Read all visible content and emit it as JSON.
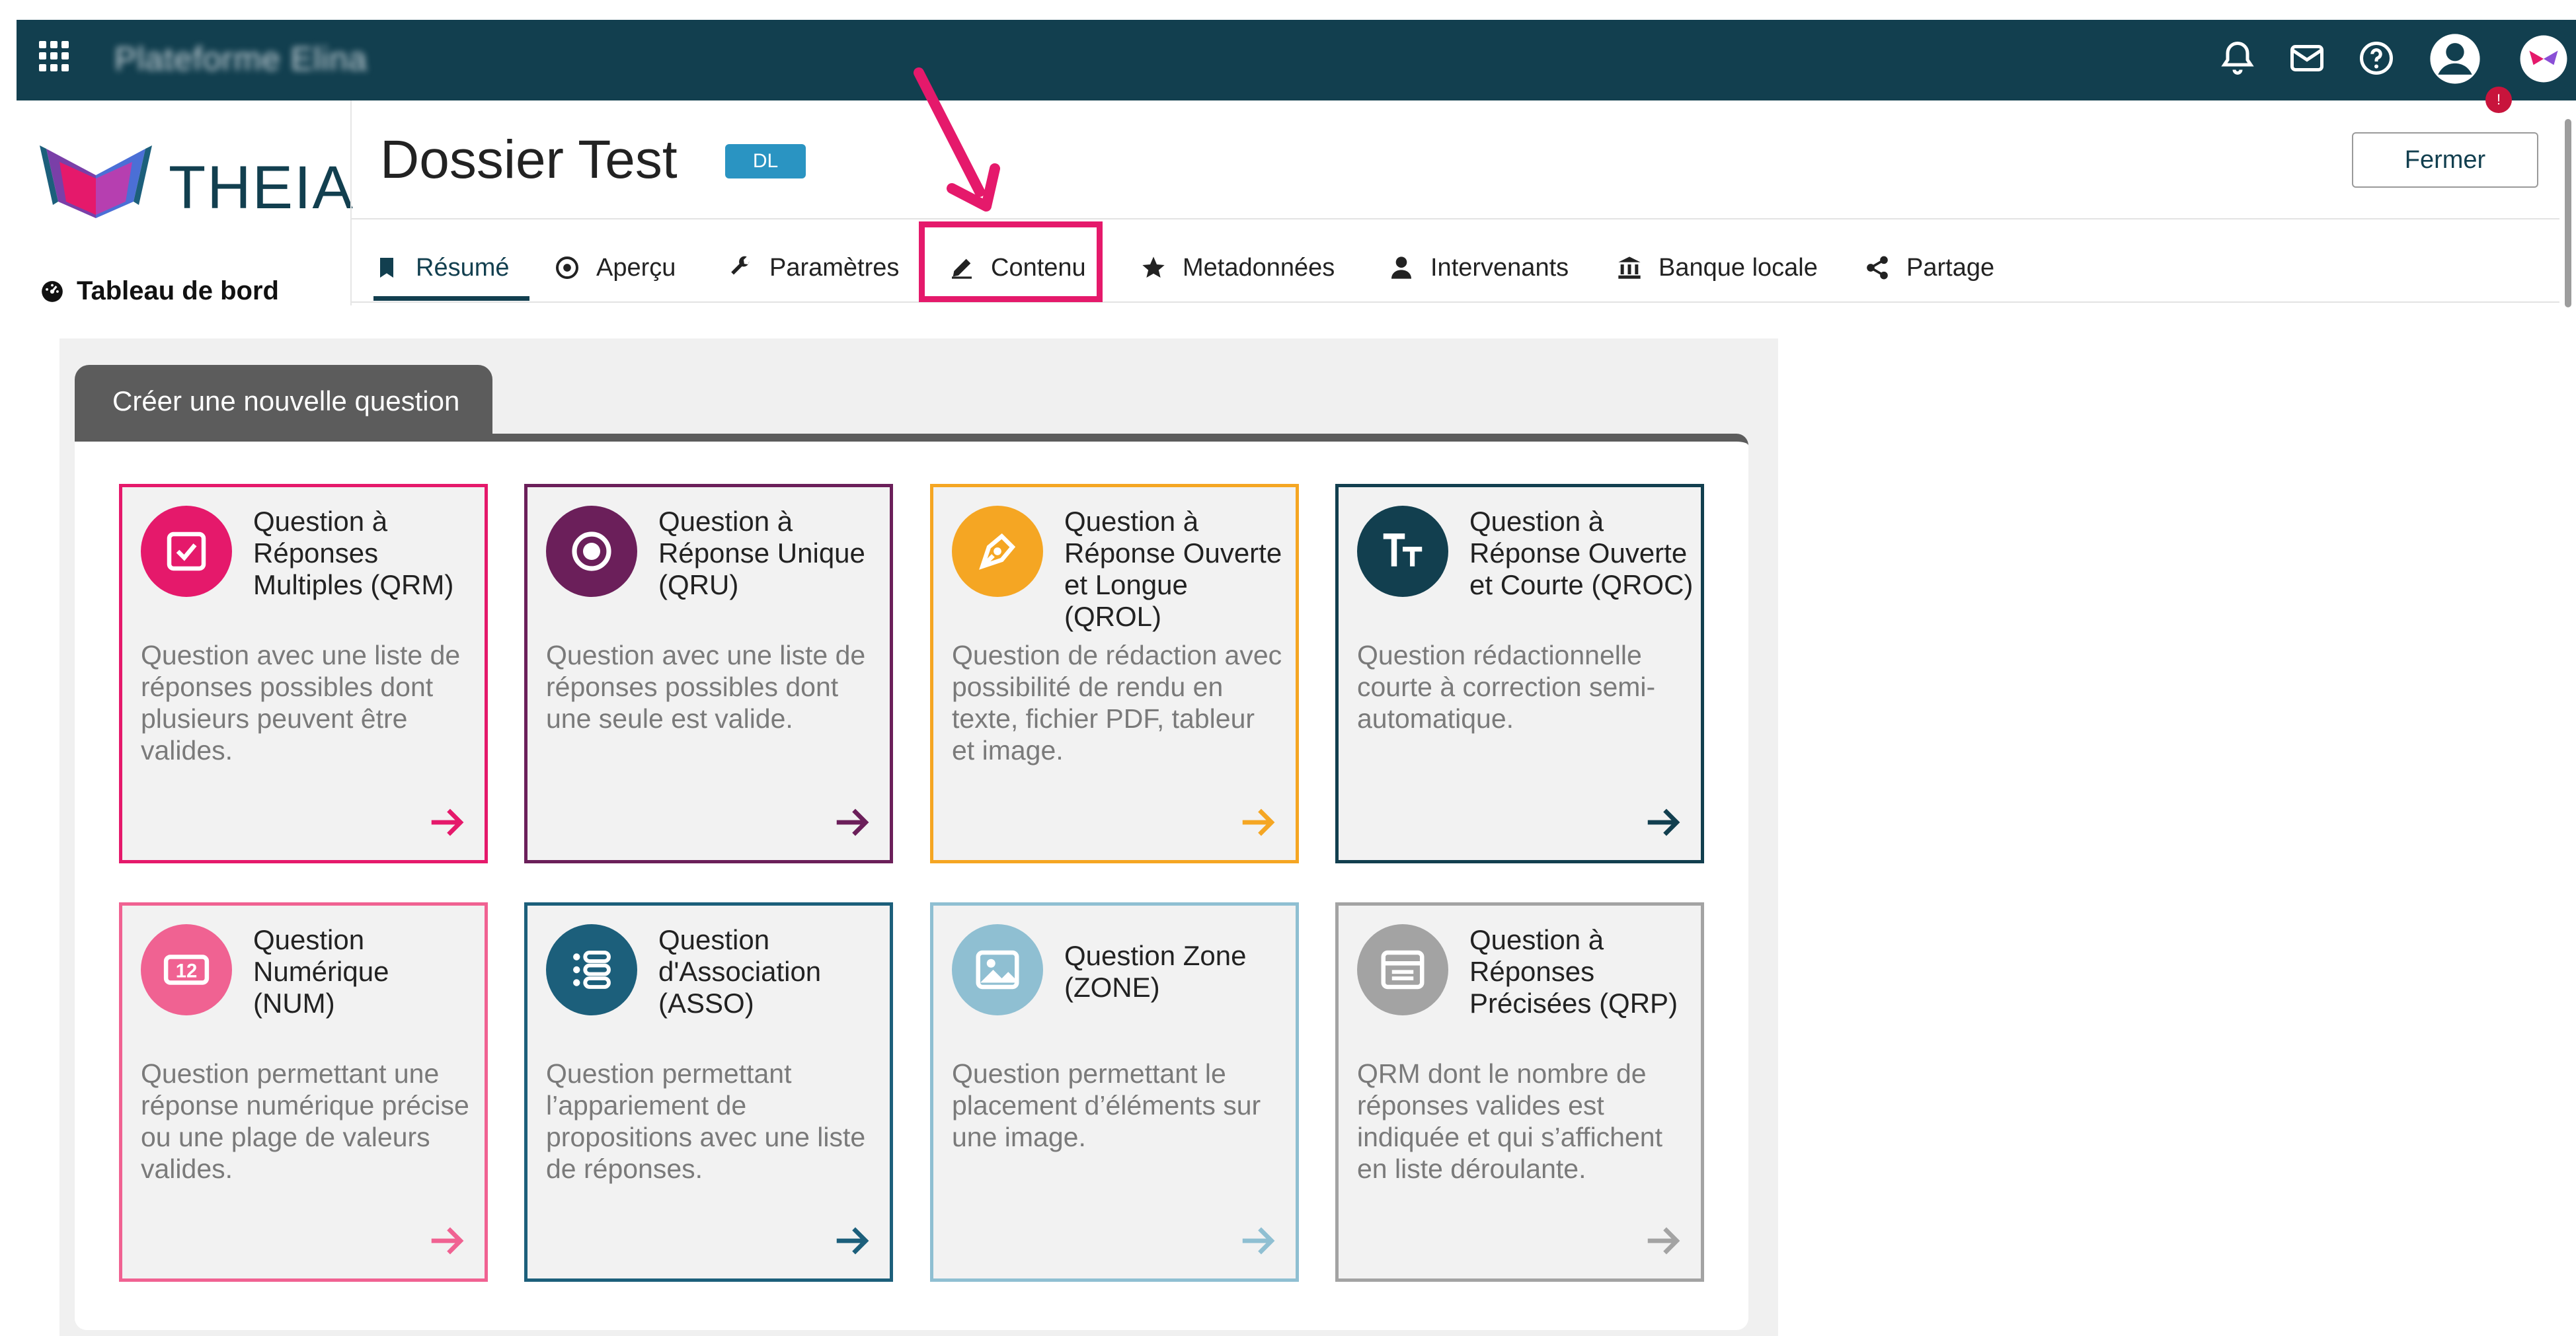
{
  "topbar": {
    "platform_name": "Plateforme Elina",
    "icons": [
      "apps-grid-icon",
      "bell-icon",
      "envelope-icon",
      "help-circle-icon",
      "user-avatar-icon",
      "butterfly-logo-icon"
    ],
    "avatar_badge": "!"
  },
  "brand": {
    "name": "THEIA"
  },
  "sidebar": {
    "dashboard_label": "Tableau de bord"
  },
  "header": {
    "title": "Dossier Test",
    "badge": "DL",
    "close_label": "Fermer"
  },
  "tabs": [
    {
      "label": "Résumé",
      "icon": "bookmark-icon",
      "active": true
    },
    {
      "label": "Aperçu",
      "icon": "eye-icon"
    },
    {
      "label": "Paramètres",
      "icon": "wrench-icon"
    },
    {
      "label": "Contenu",
      "icon": "pencil-icon",
      "highlighted": true
    },
    {
      "label": "Metadonnées",
      "icon": "star-icon"
    },
    {
      "label": "Intervenants",
      "icon": "user-icon"
    },
    {
      "label": "Banque locale",
      "icon": "bank-icon"
    },
    {
      "label": "Partage",
      "icon": "share-icon"
    }
  ],
  "panel": {
    "tab_label": "Créer une nouvelle question",
    "cards": [
      {
        "title": "Question à Réponses Multiples (QRM)",
        "description": "Question avec une liste de réponses possibles dont plusieurs peuvent être valides.",
        "icon": "checkbox-icon",
        "color": "#e5196b"
      },
      {
        "title": "Question à Réponse Unique (QRU)",
        "description": "Question avec une liste de réponses possibles dont une seule est valide.",
        "icon": "radio-icon",
        "color": "#6b1f5a"
      },
      {
        "title": "Question à Réponse Ouverte et Longue (QROL)",
        "description": "Question de rédaction avec possibilité de rendu en texte, fichier PDF, tableur et image.",
        "icon": "pen-nib-icon",
        "color": "#f5a623"
      },
      {
        "title": "Question à Réponse Ouverte et Courte (QROC)",
        "description": "Question rédactionnelle courte à correction semi-automatique.",
        "icon": "text-size-icon",
        "color": "#123f4f"
      },
      {
        "title": "Question Numérique (NUM)",
        "description": "Question permettant une réponse numérique précise ou une plage de valeurs valides.",
        "icon": "number-12-icon",
        "color": "#f06292",
        "number_glyph": "12"
      },
      {
        "title": "Question d'Association (ASSO)",
        "description": "Question permettant l’appariement de propositions avec une liste de réponses.",
        "icon": "list-match-icon",
        "color": "#1c5f7b"
      },
      {
        "title": "Question Zone (ZONE)",
        "description": "Question permettant le placement d’éléments sur une image.",
        "icon": "image-icon",
        "color": "#8fbfd2"
      },
      {
        "title": "Question à Réponses Précisées (QRP)",
        "description": "QRM dont le nombre de réponses valides est indiquée et qui s’affichent en liste déroulante.",
        "icon": "dropdown-list-icon",
        "color": "#a3a3a3"
      }
    ]
  },
  "annotation": {
    "color": "#e5196b"
  }
}
